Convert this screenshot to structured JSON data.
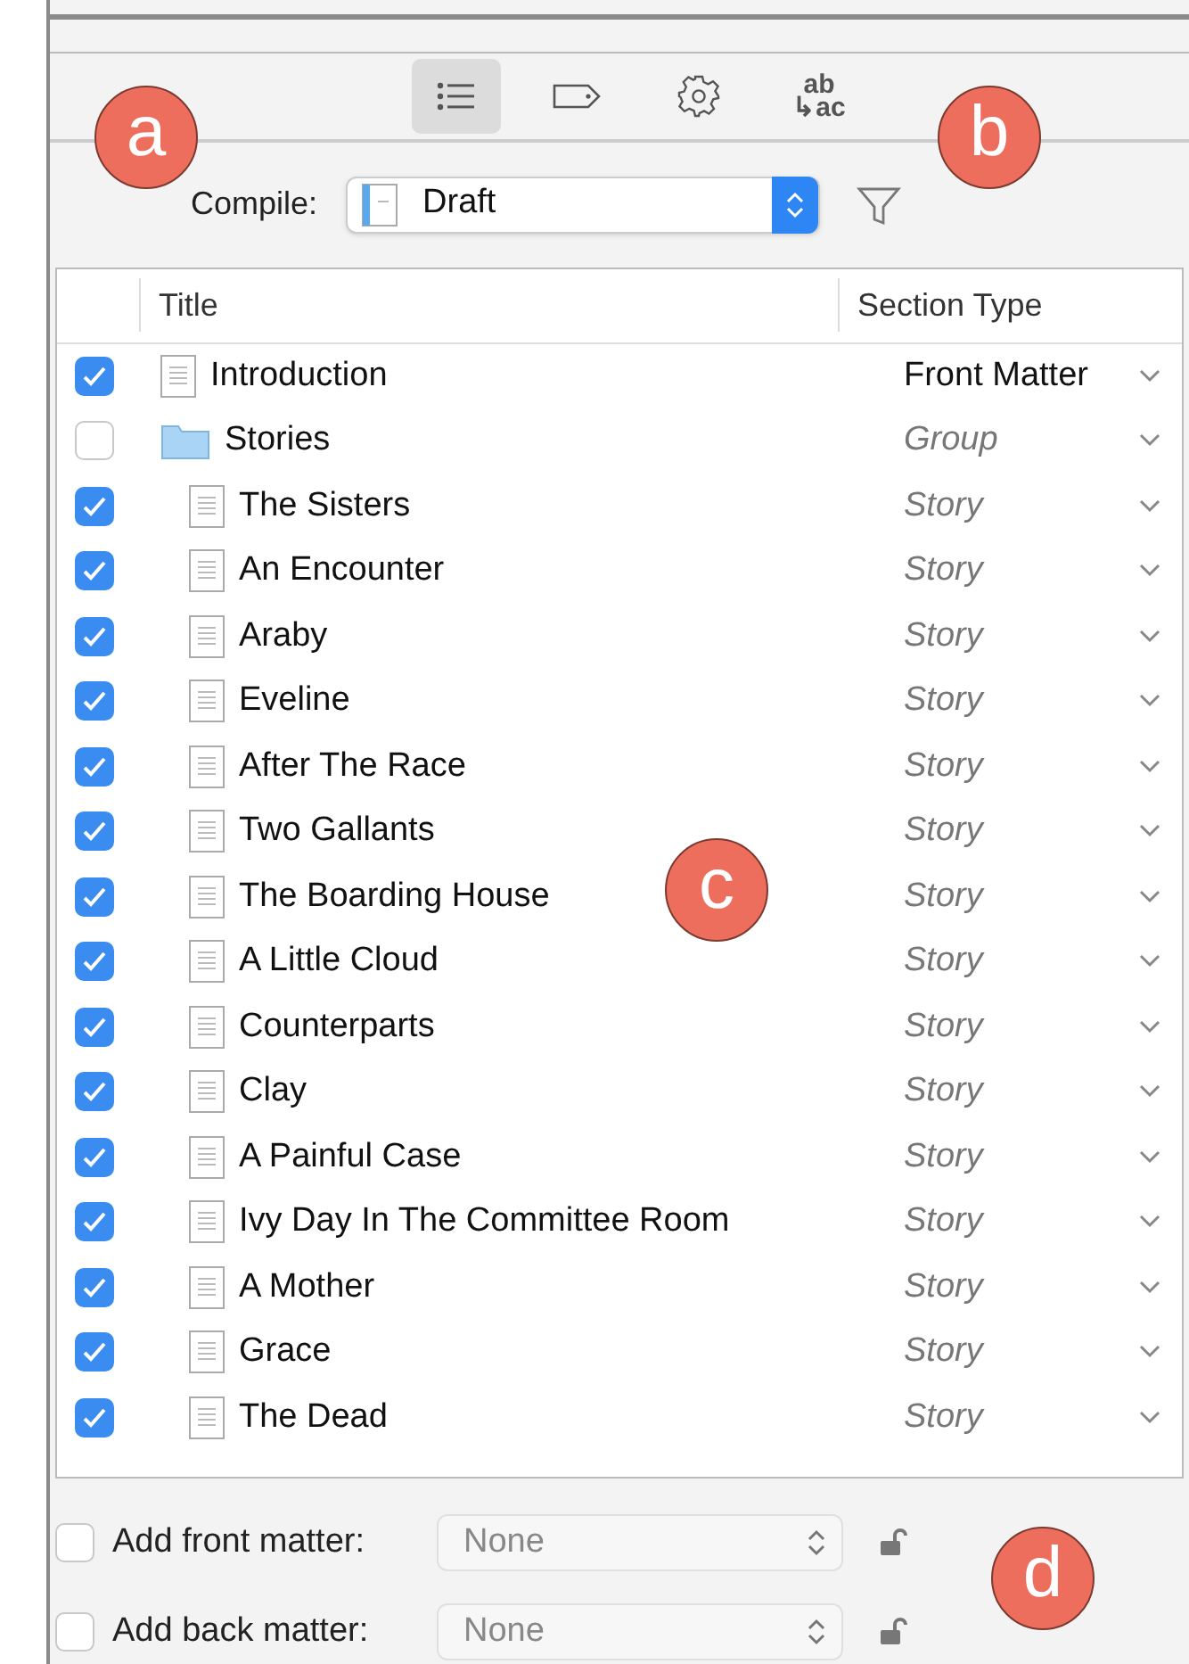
{
  "toolbar": {
    "tabs": [
      {
        "kind": "list",
        "selected": true
      },
      {
        "kind": "tag",
        "selected": false
      },
      {
        "kind": "gear",
        "selected": false
      },
      {
        "kind": "replace",
        "selected": false,
        "top": "ab",
        "bottom": "↳ac"
      }
    ]
  },
  "compile": {
    "label": "Compile:",
    "value": "Draft"
  },
  "table": {
    "columns": [
      "Title",
      "Section Type"
    ],
    "rows": [
      {
        "title": "Introduction",
        "kind": "document",
        "checked": true,
        "section_type": "Front Matter",
        "inherited": false
      },
      {
        "title": "Stories",
        "kind": "folder",
        "checked": false,
        "section_type": "Group",
        "inherited": true,
        "children": [
          {
            "title": "The Sisters",
            "kind": "document",
            "checked": true,
            "section_type": "Story",
            "inherited": true
          },
          {
            "title": "An Encounter",
            "kind": "document",
            "checked": true,
            "section_type": "Story",
            "inherited": true
          },
          {
            "title": "Araby",
            "kind": "document",
            "checked": true,
            "section_type": "Story",
            "inherited": true
          },
          {
            "title": "Eveline",
            "kind": "document",
            "checked": true,
            "section_type": "Story",
            "inherited": true
          },
          {
            "title": "After The Race",
            "kind": "document",
            "checked": true,
            "section_type": "Story",
            "inherited": true
          },
          {
            "title": "Two Gallants",
            "kind": "document",
            "checked": true,
            "section_type": "Story",
            "inherited": true
          },
          {
            "title": "The Boarding House",
            "kind": "document",
            "checked": true,
            "section_type": "Story",
            "inherited": true
          },
          {
            "title": "A Little Cloud",
            "kind": "document",
            "checked": true,
            "section_type": "Story",
            "inherited": true
          },
          {
            "title": "Counterparts",
            "kind": "document",
            "checked": true,
            "section_type": "Story",
            "inherited": true
          },
          {
            "title": "Clay",
            "kind": "document",
            "checked": true,
            "section_type": "Story",
            "inherited": true
          },
          {
            "title": "A Painful Case",
            "kind": "document",
            "checked": true,
            "section_type": "Story",
            "inherited": true
          },
          {
            "title": "Ivy Day In The Committee Room",
            "kind": "document",
            "checked": true,
            "section_type": "Story",
            "inherited": true
          },
          {
            "title": "A Mother",
            "kind": "document",
            "checked": true,
            "section_type": "Story",
            "inherited": true
          },
          {
            "title": "Grace",
            "kind": "document",
            "checked": true,
            "section_type": "Story",
            "inherited": true
          },
          {
            "title": "The Dead",
            "kind": "document",
            "checked": true,
            "section_type": "Story",
            "inherited": true
          }
        ]
      }
    ]
  },
  "matter": [
    {
      "label": "Add front matter:",
      "checked": false,
      "value": "None"
    },
    {
      "label": "Add back matter:",
      "checked": false,
      "value": "None"
    }
  ],
  "callouts": [
    {
      "letter": "a"
    },
    {
      "letter": "b"
    },
    {
      "letter": "c"
    },
    {
      "letter": "d"
    }
  ]
}
